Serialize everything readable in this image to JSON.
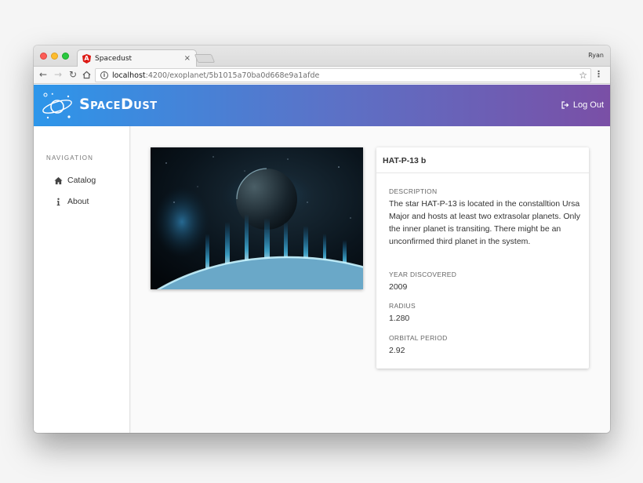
{
  "browser": {
    "tab_title": "Spacedust",
    "tab_close": "×",
    "profile_name": "Ryan",
    "url_host": "localhost",
    "url_path": ":4200/exoplanet/5b1015a70ba0d668e9a1afde",
    "icons": [
      "back-icon",
      "forward-icon",
      "reload-icon",
      "home-icon",
      "info-icon",
      "star-icon",
      "menu-icon"
    ]
  },
  "header": {
    "brand": "SpaceDust",
    "logout_label": "Log Out",
    "gradient": [
      "#2d96ea",
      "#7a4fa6"
    ]
  },
  "sidebar": {
    "heading": "NAVIGATION",
    "items": [
      {
        "label": "Catalog",
        "icon": "home-icon"
      },
      {
        "label": "About",
        "icon": "info-icon"
      }
    ]
  },
  "planet": {
    "name": "HAT-P-13 b",
    "fields": [
      {
        "label": "DESCRIPTION",
        "value": "The star HAT-P-13 is located in the constalltion Ursa Major and hosts at least two extrasolar planets. Only the inner planet is transiting. There might be an unconfirmed third planet in the system."
      },
      {
        "label": "YEAR DISCOVERED",
        "value": "2009"
      },
      {
        "label": "RADIUS",
        "value": "1.280"
      },
      {
        "label": "ORBITAL PERIOD",
        "value": "2.92"
      }
    ]
  }
}
